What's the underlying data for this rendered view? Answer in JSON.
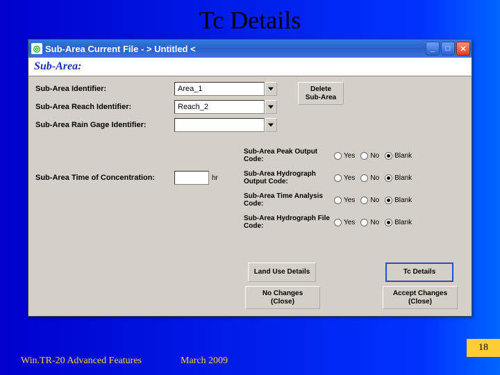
{
  "slide": {
    "title": "Tc Details",
    "footer_left": "Win.TR-20 Advanced Features",
    "footer_center": "March 2009",
    "number": "18"
  },
  "window": {
    "title": "Sub-Area   Current File - > Untitled <",
    "subheader": "Sub-Area:"
  },
  "form": {
    "identifier_label": "Sub-Area Identifier:",
    "identifier_value": "Area_1",
    "reach_label": "Sub-Area Reach Identifier:",
    "reach_value": "Reach_2",
    "rain_label": "Sub-Area Rain Gage Identifier:",
    "rain_value": "",
    "toc_label": "Sub-Area Time of Concentration:",
    "toc_value": "",
    "toc_unit": "hr",
    "delete_btn": "Delete Sub-Area"
  },
  "codes": {
    "rows": [
      {
        "label": "Sub-Area Peak Output Code:",
        "selected": "Blank"
      },
      {
        "label": "Sub-Area Hydrograph Output Code:",
        "selected": "Blank"
      },
      {
        "label": "Sub-Area Time Analysis Code:",
        "selected": "Blank"
      },
      {
        "label": "Sub-Area Hydrograph File Code:",
        "selected": "Blank"
      }
    ],
    "opts": {
      "yes": "Yes",
      "no": "No",
      "blank": "Blank"
    }
  },
  "buttons": {
    "land_use": "Land Use Details",
    "tc_details": "Tc Details",
    "no_changes": "No Changes (Close)",
    "accept": "Accept Changes (Close)"
  }
}
